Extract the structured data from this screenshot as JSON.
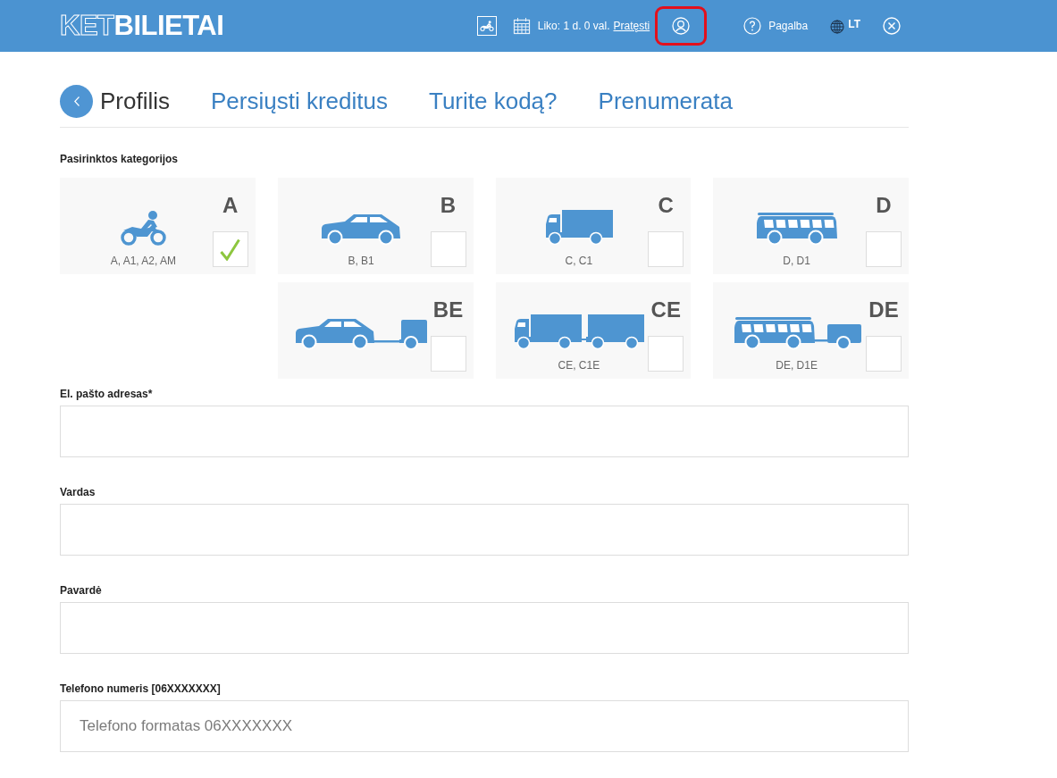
{
  "header": {
    "logo": {
      "outline_part": "KET",
      "solid_part": "BILIETAI"
    },
    "category_button": {
      "kind": "motorcycle"
    },
    "time_left": "Liko: 1 d. 0 val.",
    "renew_link": "Pratęsti",
    "profile_button": {
      "highlighted": true
    },
    "help": "Pagalba",
    "language": "LT"
  },
  "tabs": [
    {
      "label": "Profilis",
      "selected": true
    },
    {
      "label": "Persiųsti kreditus",
      "selected": false
    },
    {
      "label": "Turite kodą?",
      "selected": false
    },
    {
      "label": "Prenumerata",
      "selected": false
    }
  ],
  "categories_title": "Pasirinktos kategorijos",
  "category_rows": [
    [
      {
        "letter": "A",
        "label": "A, A1, A2, AM",
        "kind": "motorcycle",
        "checked": true
      },
      {
        "letter": "B",
        "label": "B, B1",
        "kind": "car",
        "checked": false
      },
      {
        "letter": "C",
        "label": "C, C1",
        "kind": "truck",
        "checked": false
      },
      {
        "letter": "D",
        "label": "D, D1",
        "kind": "bus",
        "checked": false
      }
    ],
    [
      {
        "letter": "BE",
        "kind": "car_trailer",
        "checked": false
      },
      {
        "letter": "CE",
        "label": "CE, C1E",
        "kind": "truck_trailer",
        "checked": false
      },
      {
        "letter": "DE",
        "label": "DE, D1E",
        "kind": "bus_trailer",
        "checked": false
      }
    ]
  ],
  "fields": [
    {
      "label": "El. pašto adresas*"
    },
    {
      "label": "Vardas"
    },
    {
      "label": "Pavardė"
    },
    {
      "label": "Telefono numeris [06XXXXXXX]",
      "placeholder": "Telefono formatas 06XXXXXXX"
    }
  ]
}
